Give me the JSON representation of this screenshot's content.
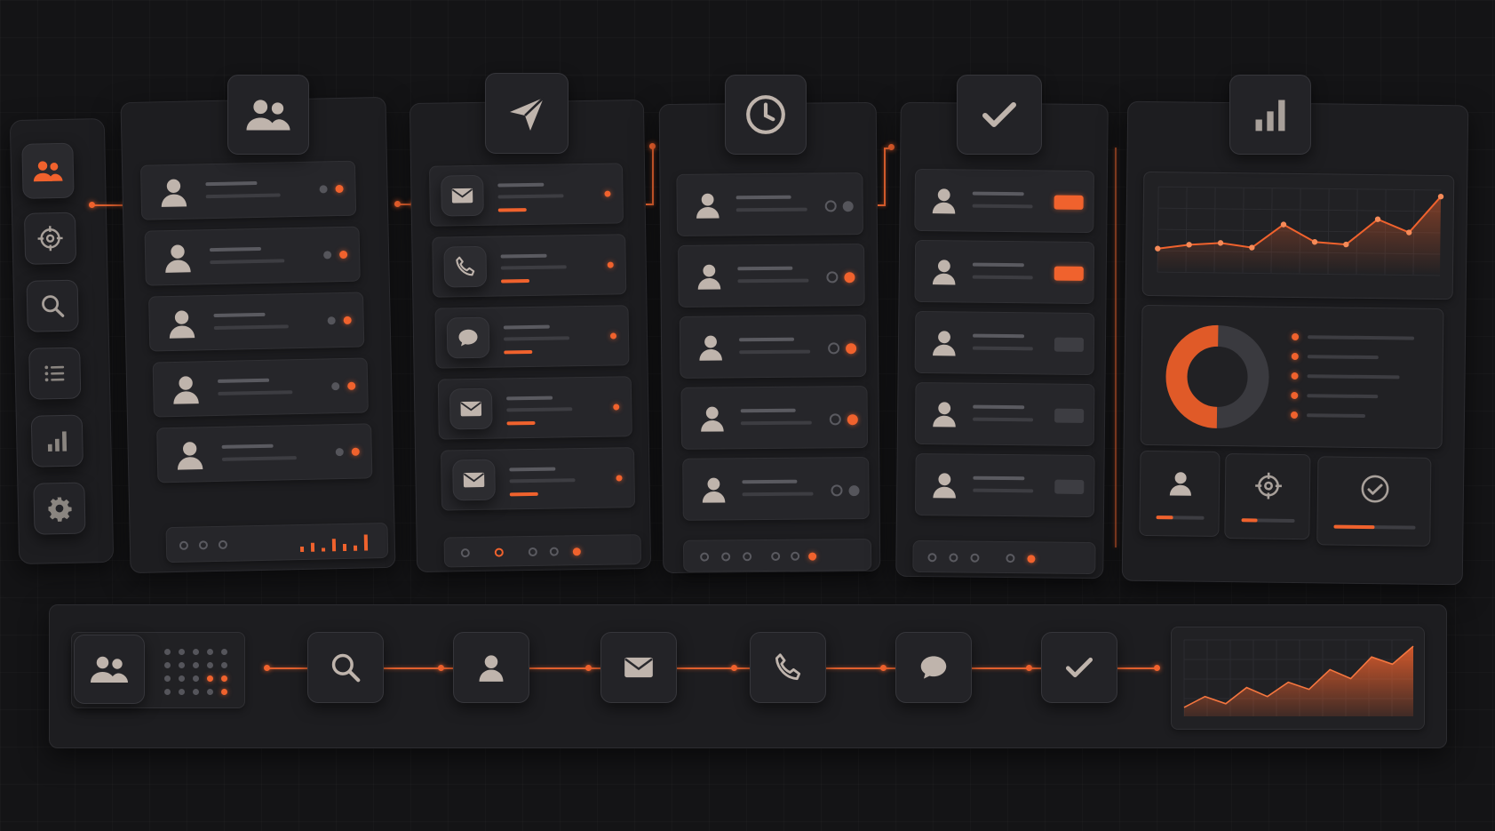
{
  "colors": {
    "accent": "#f0622d",
    "background": "#141416",
    "panel": "#1d1d20",
    "icon": "#bfb4ac"
  },
  "sidebar": {
    "items": [
      {
        "icon": "users-icon",
        "active": true
      },
      {
        "icon": "crosshair-icon",
        "active": false
      },
      {
        "icon": "search-icon",
        "active": false
      },
      {
        "icon": "list-icon",
        "active": false
      },
      {
        "icon": "bar-chart-icon",
        "active": false
      },
      {
        "icon": "gear-icon",
        "active": false
      }
    ]
  },
  "columns": [
    {
      "header_icon": "users-icon",
      "row_icon": "user-icon",
      "row_count": 5
    },
    {
      "header_icon": "send-icon",
      "row_icons": [
        "mail-icon",
        "phone-icon",
        "chat-icon",
        "mail-icon",
        "mail-icon"
      ],
      "row_count": 5
    },
    {
      "header_icon": "clock-icon",
      "row_icon": "user-icon",
      "row_count": 5
    },
    {
      "header_icon": "check-icon",
      "row_icon": "user-icon",
      "row_count": 5,
      "status_badges": [
        "active",
        "active",
        "inactive",
        "inactive",
        "inactive"
      ]
    },
    {
      "header_icon": "bar-chart-icon"
    }
  ],
  "analytics": {
    "line_chart_values": [
      22,
      26,
      28,
      24,
      46,
      30,
      28,
      52,
      40,
      74
    ],
    "donut_fraction": 0.5,
    "stat_cards": [
      {
        "icon": "user-icon",
        "progress": 0.35
      },
      {
        "icon": "crosshair-icon",
        "progress": 0.3
      },
      {
        "icon": "check-circle-icon",
        "progress": 0.5
      }
    ]
  },
  "workflow": {
    "steps": [
      "search-icon",
      "user-icon",
      "mail-icon",
      "phone-icon",
      "chat-icon",
      "check-icon"
    ],
    "area_chart_values": [
      10,
      22,
      14,
      32,
      22,
      38,
      30,
      52,
      42,
      66,
      58,
      78
    ]
  }
}
